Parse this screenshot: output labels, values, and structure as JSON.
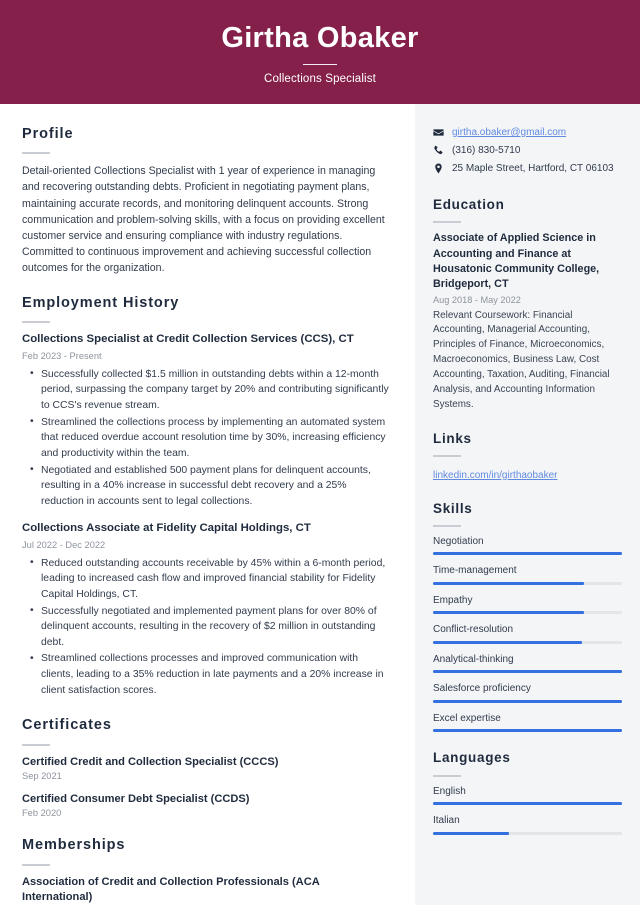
{
  "theme": {
    "banner_bg": "#85204a",
    "banner_text": "#ffffff",
    "sidebar_bg": "#f4f5f7",
    "heading_color": "#1f2b3d",
    "body_color": "#323c4d",
    "muted_color": "#8d939d",
    "accent_bar": "#3570e0",
    "link_color": "#5f8ae0",
    "rule_color": "#c9ccd3"
  },
  "header": {
    "name": "Girtha Obaker",
    "job_title": "Collections Specialist"
  },
  "main": {
    "profile": {
      "heading": "Profile",
      "text": "Detail-oriented Collections Specialist with 1 year of experience in managing and recovering outstanding debts. Proficient in negotiating payment plans, maintaining accurate records, and monitoring delinquent accounts. Strong communication and problem-solving skills, with a focus on providing excellent customer service and ensuring compliance with industry regulations. Committed to continuous improvement and achieving successful collection outcomes for the organization."
    },
    "employment": {
      "heading": "Employment History",
      "jobs": [
        {
          "title": "Collections Specialist at Credit Collection Services (CCS), CT",
          "date": "Feb 2023 - Present",
          "bullets": [
            "Successfully collected $1.5 million in outstanding debts within a 12-month period, surpassing the company target by 20% and contributing significantly to CCS's revenue stream.",
            "Streamlined the collections process by implementing an automated system that reduced overdue account resolution time by 30%, increasing efficiency and productivity within the team.",
            "Negotiated and established 500 payment plans for delinquent accounts, resulting in a 40% increase in successful debt recovery and a 25% reduction in accounts sent to legal collections."
          ]
        },
        {
          "title": "Collections Associate at Fidelity Capital Holdings, CT",
          "date": "Jul 2022 - Dec 2022",
          "bullets": [
            "Reduced outstanding accounts receivable by 45% within a 6-month period, leading to increased cash flow and improved financial stability for Fidelity Capital Holdings, CT.",
            "Successfully negotiated and implemented payment plans for over 80% of delinquent accounts, resulting in the recovery of $2 million in outstanding debt.",
            "Streamlined collections processes and improved communication with clients, leading to a 35% reduction in late payments and a 20% increase in client satisfaction scores."
          ]
        }
      ]
    },
    "certificates": {
      "heading": "Certificates",
      "items": [
        {
          "name": "Certified Credit and Collection Specialist (CCCS)",
          "date": "Sep 2021"
        },
        {
          "name": "Certified Consumer Debt Specialist (CCDS)",
          "date": "Feb 2020"
        }
      ]
    },
    "memberships": {
      "heading": "Memberships",
      "items": [
        {
          "name": "Association of Credit and Collection Professionals (ACA International)"
        }
      ]
    }
  },
  "sidebar": {
    "contact": {
      "email": "girtha.obaker@gmail.com",
      "phone": "(316) 830-5710",
      "address": "25 Maple Street, Hartford, CT 06103",
      "email_icon": "envelope-icon",
      "phone_icon": "phone-icon",
      "address_icon": "map-pin-icon"
    },
    "education": {
      "heading": "Education",
      "degree": "Associate of Applied Science in Accounting and Finance at Housatonic Community College, Bridgeport, CT",
      "date": "Aug 2018 - May 2022",
      "coursework": "Relevant Coursework: Financial Accounting, Managerial Accounting, Principles of Finance, Microeconomics, Macroeconomics, Business Law, Cost Accounting, Taxation, Auditing, Financial Analysis, and Accounting Information Systems."
    },
    "links": {
      "heading": "Links",
      "items": [
        {
          "label": "linkedin.com/in/girthaobaker"
        }
      ]
    },
    "skills": {
      "heading": "Skills",
      "items": [
        {
          "label": "Negotiation",
          "level": 100
        },
        {
          "label": "Time-management",
          "level": 80
        },
        {
          "label": "Empathy",
          "level": 80
        },
        {
          "label": "Conflict-resolution",
          "level": 79
        },
        {
          "label": "Analytical-thinking",
          "level": 100
        },
        {
          "label": "Salesforce proficiency",
          "level": 100
        },
        {
          "label": "Excel expertise",
          "level": 100
        }
      ]
    },
    "languages": {
      "heading": "Languages",
      "items": [
        {
          "label": "English",
          "level": 100
        },
        {
          "label": "Italian",
          "level": 40
        }
      ]
    }
  }
}
